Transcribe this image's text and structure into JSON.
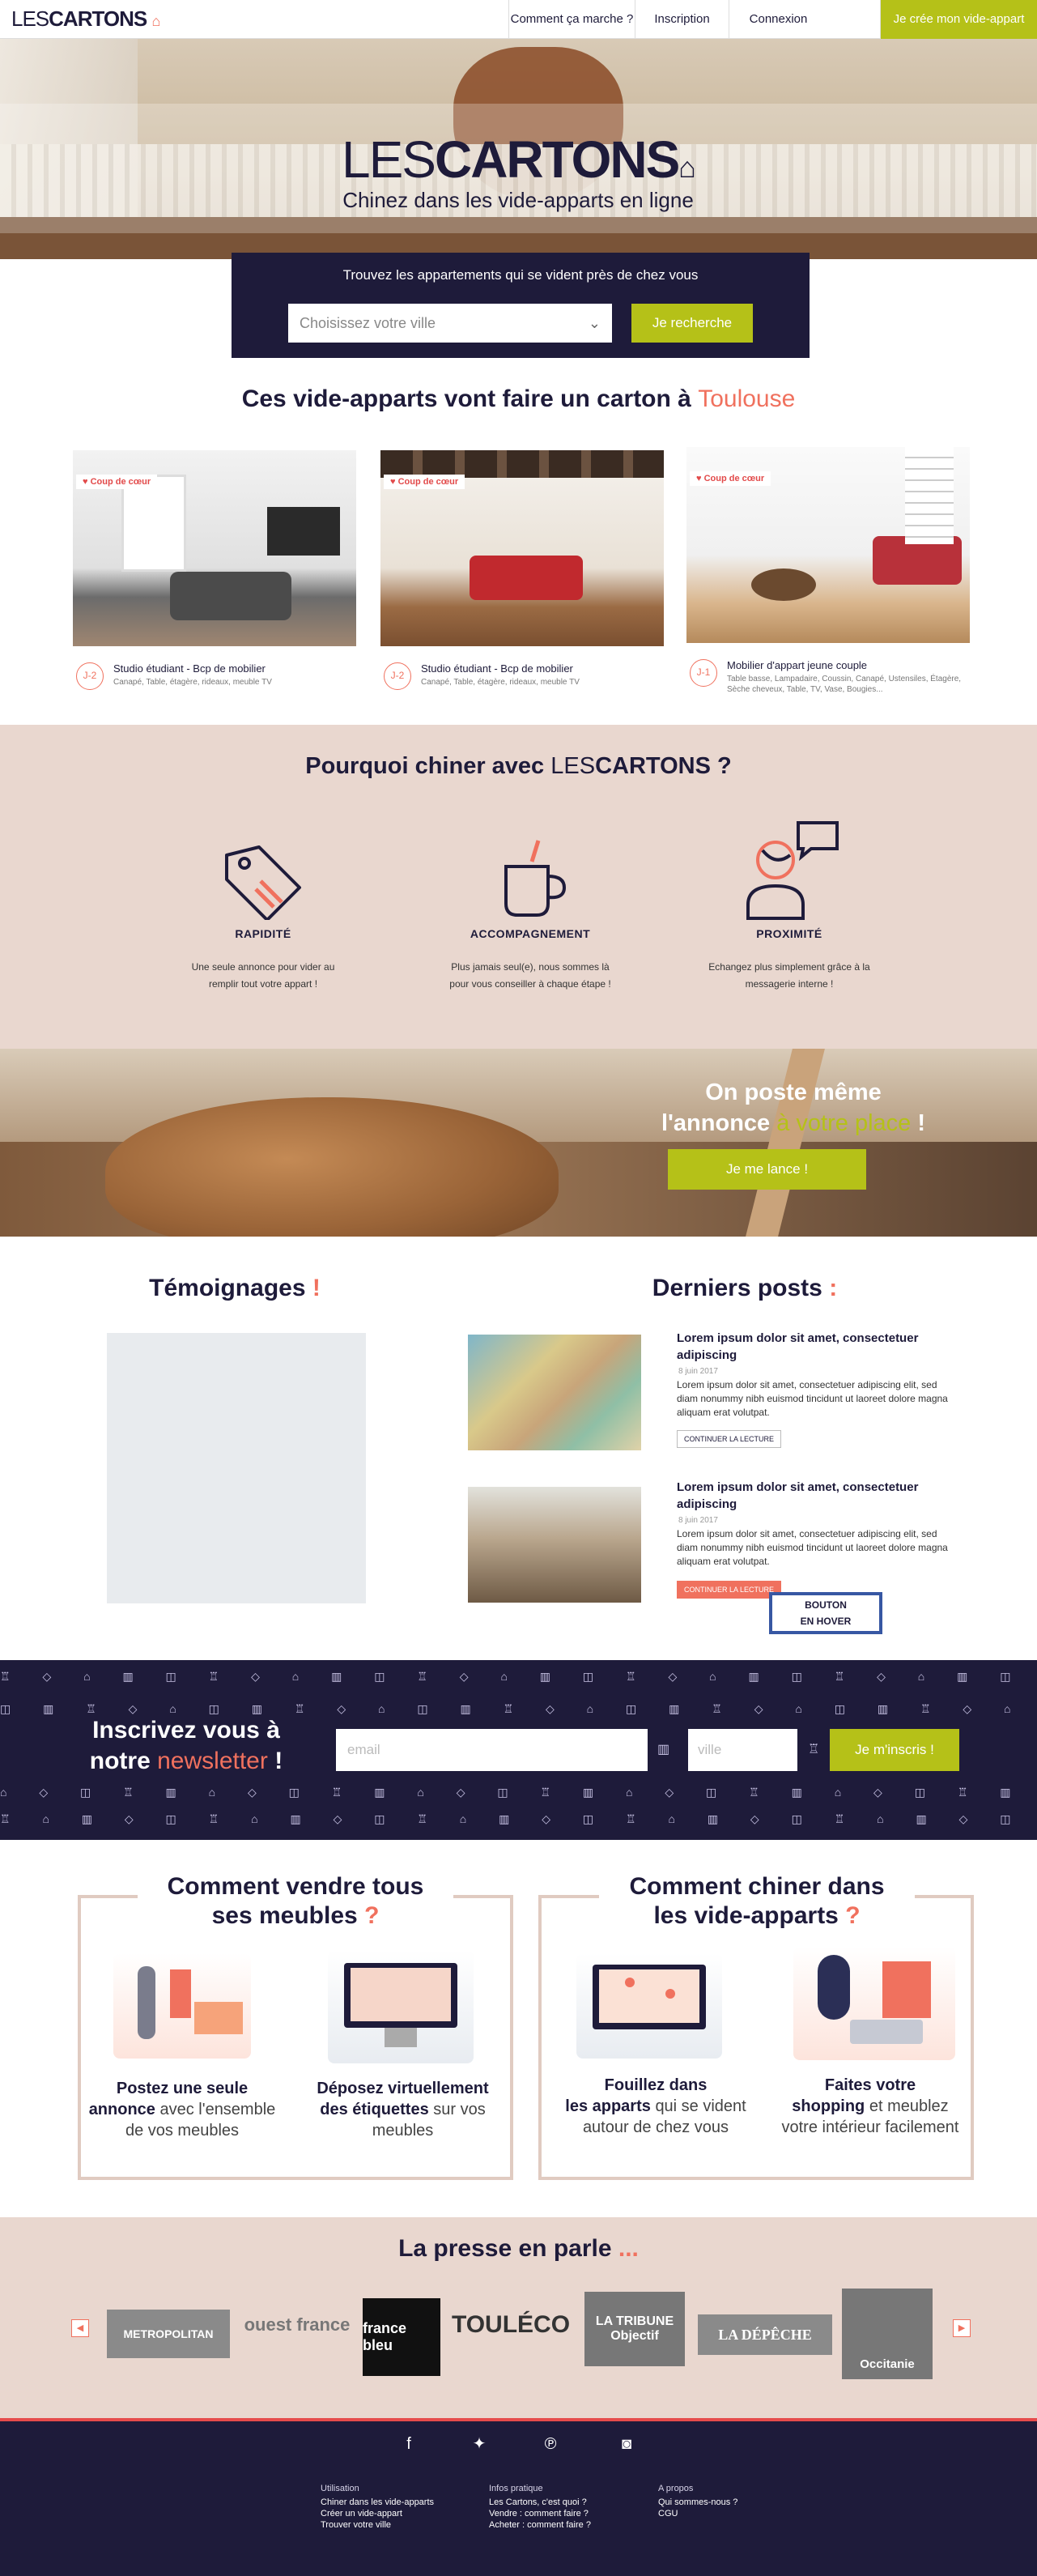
{
  "header": {
    "logo_light": "LES",
    "logo_bold": "CARTONS",
    "nav": [
      "Comment ça marche ?",
      "Inscription",
      "Connexion",
      "Je crée mon vide-appart"
    ]
  },
  "hero": {
    "logo_light": "LES",
    "logo_bold": "CARTONS",
    "tagline": "Chinez dans les vide-apparts en ligne"
  },
  "search": {
    "title": "Trouvez les appartements qui se vident près de chez vous",
    "select_value": "Choisissez votre ville",
    "button": "Je recherche"
  },
  "listings": {
    "title_prefix": "Ces vide-apparts vont faire un carton à",
    "city": "Toulouse",
    "cards": [
      {
        "badge": "♥ Coup de cœur",
        "tag": "J-2",
        "title": "Studio étudiant - Bcp de mobilier",
        "desc": "Canapé, Table, étagère, rideaux, meuble TV"
      },
      {
        "badge": "♥ Coup de cœur",
        "tag": "J-2",
        "title": "Studio étudiant - Bcp de mobilier",
        "desc": "Canapé, Table, étagère, rideaux, meuble TV"
      },
      {
        "badge": "♥ Coup de cœur",
        "tag": "J-1",
        "title": "Mobilier d'appart jeune couple",
        "desc": "Table basse, Lampadaire, Coussin, Canapé, Ustensiles, Étagère, Sèche cheveux, Table, TV, Vase, Bougies..."
      }
    ]
  },
  "why": {
    "title_prefix": "Pourquoi chiner avec",
    "logo_light": "LES",
    "logo_bold": "CARTONS",
    "title_suffix": "?",
    "items": [
      {
        "title": "RAPIDITÉ",
        "text": "Une seule annonce pour vider au remplir tout votre appart !"
      },
      {
        "title": "ACCOMPAGNEMENT",
        "text": "Plus jamais seul(e), nous sommes là pour vous conseiller à chaque étape !"
      },
      {
        "title": "PROXIMITÉ",
        "text": "Echangez plus simplement grâce à la messagerie interne !"
      }
    ]
  },
  "ad": {
    "line1": "On poste même",
    "line2a": "l'annonce",
    "line2b": "à votre place",
    "line2c": "!",
    "button": "Je me lance !"
  },
  "testimonials": {
    "title": "Témoignages",
    "mark": "!"
  },
  "posts": {
    "title": "Derniers posts",
    "mark": ":",
    "items": [
      {
        "title": "Lorem ipsum dolor sit amet, consectetuer adipiscing",
        "date": "8 juin 2017",
        "text": "Lorem ipsum dolor sit amet, consectetuer adipiscing elit, sed diam nonummy nibh euismod tincidunt ut laoreet dolore magna aliquam erat volutpat.",
        "button": "CONTINUER LA LECTURE"
      },
      {
        "title": "Lorem ipsum dolor sit amet, consectetuer adipiscing",
        "date": "8 juin 2017",
        "text": "Lorem ipsum dolor sit amet, consectetuer adipiscing elit, sed diam nonummy nibh euismod tincidunt ut laoreet dolore magna aliquam erat volutpat.",
        "button": "CONTINUER LA LECTURE"
      }
    ],
    "hover_note_1": "BOUTON",
    "hover_note_2": "EN HOVER"
  },
  "newsletter": {
    "title_a": "Inscrivez vous à",
    "title_b": "notre",
    "title_c": "newsletter",
    "title_d": "!",
    "email_placeholder": "email",
    "city_placeholder": "ville",
    "button": "Je m'inscris !"
  },
  "how_sell": {
    "title_a": "Comment vendre tous",
    "title_b": "ses meubles",
    "mark": "?",
    "cols": [
      {
        "b1": "Postez une seule",
        "b2": "annonce",
        "t": "avec l'ensemble de vos meubles"
      },
      {
        "b1": "Déposez virtuellement",
        "b2": "des étiquettes",
        "t": "sur vos meubles"
      }
    ]
  },
  "how_buy": {
    "title_a": "Comment chiner dans",
    "title_b": "les vide-apparts",
    "mark": "?",
    "cols": [
      {
        "b1": "Fouillez dans",
        "b2": "les apparts",
        "t": "qui se vident autour de chez vous"
      },
      {
        "b1": "Faites votre",
        "b2": "shopping",
        "t": "et meublez votre intérieur facilement"
      }
    ]
  },
  "press": {
    "title": "La presse en parle",
    "mark": "...",
    "logos": [
      "METROPOLITAN",
      "ouest france",
      "france bleu",
      "TOULÉCO",
      "LA TRIBUNE Objectif",
      "LA DÉPÊCHE",
      "Occitanie"
    ]
  },
  "footer": {
    "social": [
      "facebook-icon",
      "twitter-icon",
      "pinterest-icon",
      "instagram-icon"
    ],
    "cols": [
      [
        "Utilisation",
        "Chiner dans les vide-apparts",
        "Créer un vide-appart",
        "Trouver votre ville"
      ],
      [
        "Infos pratique",
        "Les Cartons, c'est quoi ?",
        "Vendre : comment faire ?",
        "Acheter : comment faire ?"
      ],
      [
        "A propos",
        "Qui sommes-nous ?",
        "CGU"
      ]
    ]
  },
  "colors": {
    "navy": "#1e1b3a",
    "lime": "#b5c118",
    "coral": "#f0715e",
    "blush": "#e9d7cf"
  }
}
